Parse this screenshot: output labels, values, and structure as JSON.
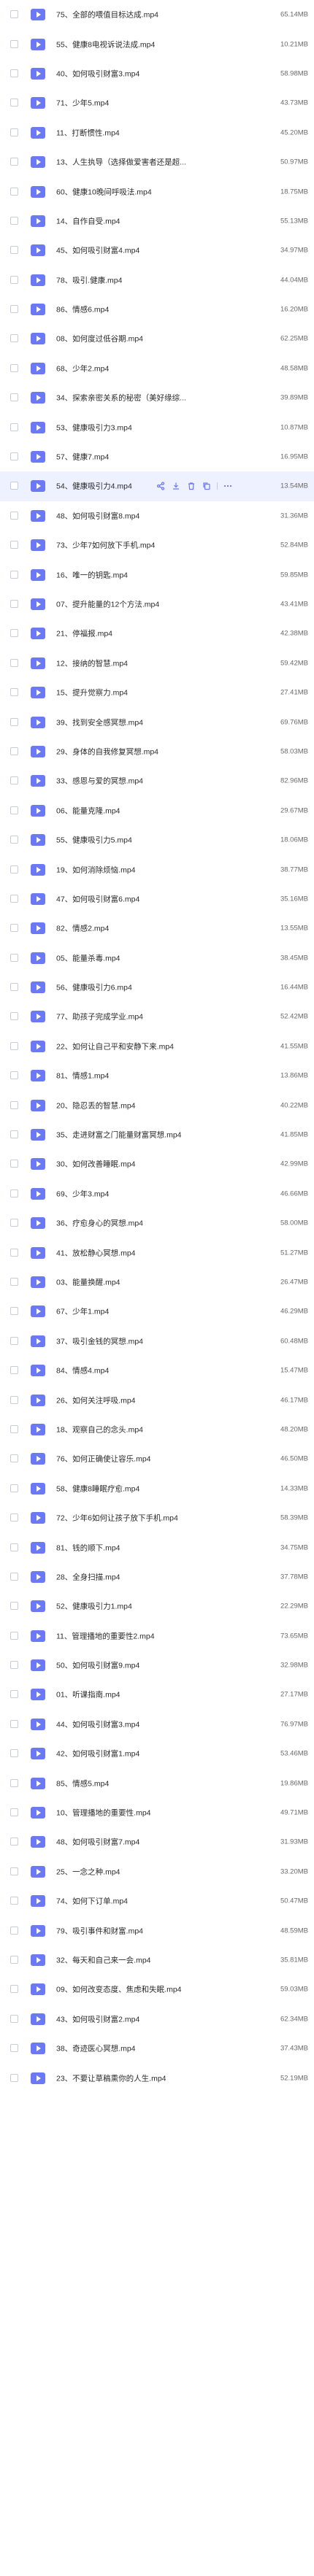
{
  "files": [
    {
      "name": "75、全部的喂值目标达成.mp4",
      "size": "65.14MB"
    },
    {
      "name": "55、健康8电视诉说法成.mp4",
      "size": "10.21MB"
    },
    {
      "name": "40、如何吸引财富3.mp4",
      "size": "58.98MB"
    },
    {
      "name": "71、少年5.mp4",
      "size": "43.73MB"
    },
    {
      "name": "11、打断惯性.mp4",
      "size": "45.20MB"
    },
    {
      "name": "13、人生执导（选择做爱害者还是超...",
      "size": "50.97MB"
    },
    {
      "name": "60、健康10晚间呼吸法.mp4",
      "size": "18.75MB"
    },
    {
      "name": "14、自作自受.mp4",
      "size": "55.13MB"
    },
    {
      "name": "45、如何吸引财富4.mp4",
      "size": "34.97MB"
    },
    {
      "name": "78、吸引.健康.mp4",
      "size": "44.04MB"
    },
    {
      "name": "86、情感6.mp4",
      "size": "16.20MB"
    },
    {
      "name": "08、如何度过低谷期.mp4",
      "size": "62.25MB"
    },
    {
      "name": "68、少年2.mp4",
      "size": "48.58MB"
    },
    {
      "name": "34、探索亲密关系的秘密（美好缘综...",
      "size": "39.89MB"
    },
    {
      "name": "53、健康吸引力3.mp4",
      "size": "10.87MB"
    },
    {
      "name": "57、健康7.mp4",
      "size": "16.95MB"
    },
    {
      "name": "54、健康吸引力4.mp4",
      "size": "13.54MB",
      "highlight": true
    },
    {
      "name": "48、如何吸引财富8.mp4",
      "size": "31.36MB"
    },
    {
      "name": "73、少年7如何放下手机.mp4",
      "size": "52.84MB"
    },
    {
      "name": "16、唯一的钥匙.mp4",
      "size": "59.85MB"
    },
    {
      "name": "07、提升能量的12个方法.mp4",
      "size": "43.41MB"
    },
    {
      "name": "21、停福报.mp4",
      "size": "42.38MB"
    },
    {
      "name": "12、接纳的智慧.mp4",
      "size": "59.42MB"
    },
    {
      "name": "15、提升觉察力.mp4",
      "size": "27.41MB"
    },
    {
      "name": "39、找到安全感冥想.mp4",
      "size": "69.76MB"
    },
    {
      "name": "29、身体的自我修复冥想.mp4",
      "size": "58.03MB"
    },
    {
      "name": "33、感恩与爱的冥想.mp4",
      "size": "82.96MB"
    },
    {
      "name": "06、能量克隆.mp4",
      "size": "29.67MB"
    },
    {
      "name": "55、健康吸引力5.mp4",
      "size": "18.06MB"
    },
    {
      "name": "19、如何消除烦恼.mp4",
      "size": "38.77MB"
    },
    {
      "name": "47、如何吸引财富6.mp4",
      "size": "35.16MB"
    },
    {
      "name": "82、情感2.mp4",
      "size": "13.55MB"
    },
    {
      "name": "05、能量杀毒.mp4",
      "size": "38.45MB"
    },
    {
      "name": "56、健康吸引力6.mp4",
      "size": "16.44MB"
    },
    {
      "name": "77、助孩子完成学业.mp4",
      "size": "52.42MB"
    },
    {
      "name": "22、如何让自己平和安静下来.mp4",
      "size": "41.55MB"
    },
    {
      "name": "81、情感1.mp4",
      "size": "13.86MB"
    },
    {
      "name": "20、隐忍丢的智慧.mp4",
      "size": "40.22MB"
    },
    {
      "name": "35、走进财富之门能量财富冥想.mp4",
      "size": "41.85MB"
    },
    {
      "name": "30、如何改善睡眠.mp4",
      "size": "42.99MB"
    },
    {
      "name": "69、少年3.mp4",
      "size": "46.66MB"
    },
    {
      "name": "36、疗愈身心的冥想.mp4",
      "size": "58.00MB"
    },
    {
      "name": "41、放松静心冥想.mp4",
      "size": "51.27MB"
    },
    {
      "name": "03、能量换醒.mp4",
      "size": "26.47MB"
    },
    {
      "name": "67、少年1.mp4",
      "size": "46.29MB"
    },
    {
      "name": "37、吸引金钱的冥想.mp4",
      "size": "60.48MB"
    },
    {
      "name": "84、情感4.mp4",
      "size": "15.47MB"
    },
    {
      "name": "26、如何关注呼吸.mp4",
      "size": "46.17MB"
    },
    {
      "name": "18、观察自己的念头.mp4",
      "size": "48.20MB"
    },
    {
      "name": "76、如何正确使让容乐.mp4",
      "size": "46.50MB"
    },
    {
      "name": "58、健康8睡眠疗愈.mp4",
      "size": "14.33MB"
    },
    {
      "name": "72、少年6如何让孩子放下手机.mp4",
      "size": "58.39MB"
    },
    {
      "name": "81、钱的顺下.mp4",
      "size": "34.75MB"
    },
    {
      "name": "28、全身扫描.mp4",
      "size": "37.78MB"
    },
    {
      "name": "52、健康吸引力1.mp4",
      "size": "22.29MB"
    },
    {
      "name": "11、管理播地的重要性2.mp4",
      "size": "73.65MB"
    },
    {
      "name": "50、如何吸引财富9.mp4",
      "size": "32.98MB"
    },
    {
      "name": "01、听课指南.mp4",
      "size": "27.17MB"
    },
    {
      "name": "44、如何吸引财富3.mp4",
      "size": "76.97MB"
    },
    {
      "name": "42、如何吸引财富1.mp4",
      "size": "53.46MB"
    },
    {
      "name": "85、情感5.mp4",
      "size": "19.86MB"
    },
    {
      "name": "10、管理播地的重要性.mp4",
      "size": "49.71MB"
    },
    {
      "name": "48、如何吸引财富7.mp4",
      "size": "31.93MB"
    },
    {
      "name": "25、一念之种.mp4",
      "size": "33.20MB"
    },
    {
      "name": "74、如何下订单.mp4",
      "size": "50.47MB"
    },
    {
      "name": "79、吸引事件和财富.mp4",
      "size": "48.59MB"
    },
    {
      "name": "32、每天和自己来一会.mp4",
      "size": "35.81MB"
    },
    {
      "name": "09、如何改变态度、焦虑和失眠.mp4",
      "size": "59.03MB"
    },
    {
      "name": "43、如何吸引财富2.mp4",
      "size": "62.34MB"
    },
    {
      "name": "38、奇迹医心冥想.mp4",
      "size": "37.43MB"
    },
    {
      "name": "23、不要让草稿熏你的人生.mp4",
      "size": "52.19MB"
    }
  ],
  "actions": [
    {
      "name": "share-icon"
    },
    {
      "name": "download-icon"
    },
    {
      "name": "delete-icon"
    },
    {
      "name": "copy-icon"
    },
    {
      "name": "more-icon"
    }
  ]
}
